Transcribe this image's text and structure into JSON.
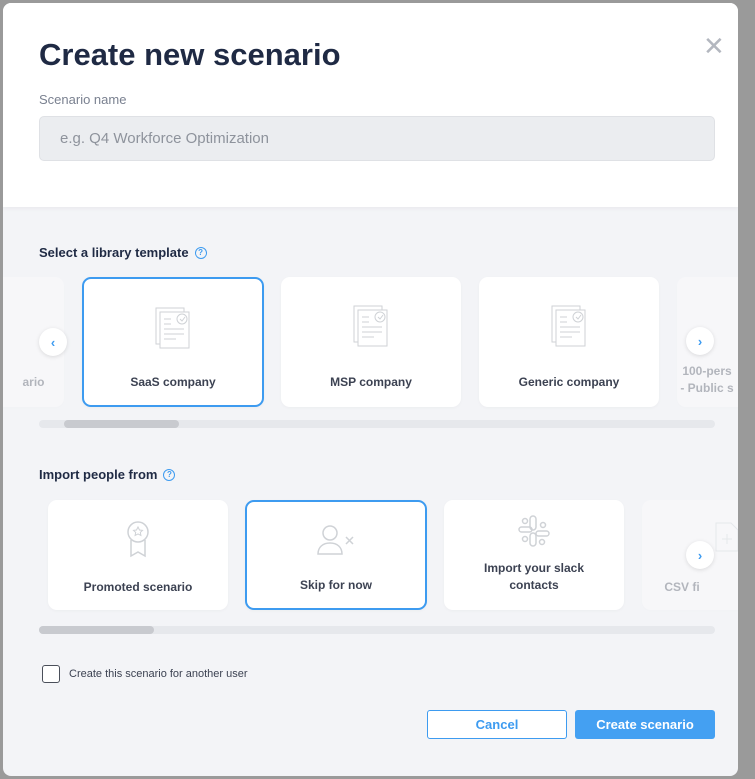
{
  "title": "Create new scenario",
  "name_label": "Scenario name",
  "name_placeholder": "e.g. Q4 Workforce Optimization",
  "templates": {
    "heading": "Select a library template",
    "items": [
      "ario",
      "SaaS company",
      "MSP company",
      "Generic company",
      "100-pers\n- Public s"
    ],
    "selected": "SaaS company"
  },
  "import": {
    "heading": "Import people from",
    "items": [
      "Promoted scenario",
      "Skip for now",
      "Import your slack contacts",
      "CSV fi"
    ],
    "selected": "Skip for now"
  },
  "checkbox_label": "Create this scenario for another user",
  "checkbox_checked": false,
  "cancel": "Cancel",
  "create": "Create scenario",
  "colors": {
    "accent": "#3d9bf0",
    "title": "#1f2a44"
  }
}
